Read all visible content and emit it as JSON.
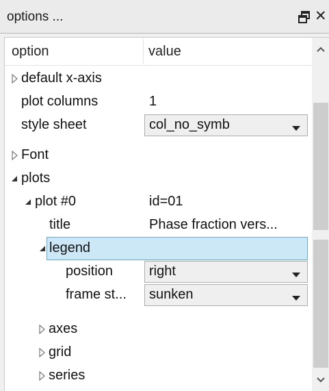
{
  "window": {
    "title": "options ...",
    "float_icon": "float-window-icon",
    "close_icon": "close-icon",
    "close_glyph": "✕"
  },
  "tree": {
    "columns": [
      "option",
      "value"
    ],
    "rows": [
      {
        "label": "default x-axis",
        "value": "",
        "expanded": false,
        "has_children": true,
        "combo": false
      },
      {
        "label": "plot columns",
        "value": "1",
        "expanded": null,
        "has_children": false,
        "combo": false
      },
      {
        "label": "style sheet",
        "value": "col_no_symb",
        "expanded": null,
        "has_children": false,
        "combo": true
      },
      {
        "label": "Font",
        "value": "",
        "expanded": false,
        "has_children": true,
        "combo": false
      },
      {
        "label": "plots",
        "value": "",
        "expanded": true,
        "has_children": true,
        "combo": false
      },
      {
        "label": "plot #0",
        "value": "id=01",
        "expanded": true,
        "has_children": true,
        "combo": false
      },
      {
        "label": "title",
        "value": "Phase fraction vers...",
        "expanded": null,
        "has_children": false,
        "combo": false
      },
      {
        "label": "legend",
        "value": "",
        "expanded": true,
        "has_children": true,
        "combo": false,
        "selected": true
      },
      {
        "label": "position",
        "value": "right",
        "expanded": null,
        "has_children": false,
        "combo": true
      },
      {
        "label": "frame st...",
        "value": "sunken",
        "expanded": null,
        "has_children": false,
        "combo": true
      },
      {
        "label": "axes",
        "value": "",
        "expanded": false,
        "has_children": true,
        "combo": false
      },
      {
        "label": "grid",
        "value": "",
        "expanded": false,
        "has_children": true,
        "combo": false
      },
      {
        "label": "series",
        "value": "",
        "expanded": false,
        "has_children": true,
        "combo": false
      }
    ]
  },
  "scrollbar": {
    "up_icon": "chevron-up-icon",
    "down_icon": "chevron-down-icon",
    "position": 0.35
  },
  "colors": {
    "selection_fill": "#cce8f6",
    "selection_border": "#68a9d1"
  }
}
